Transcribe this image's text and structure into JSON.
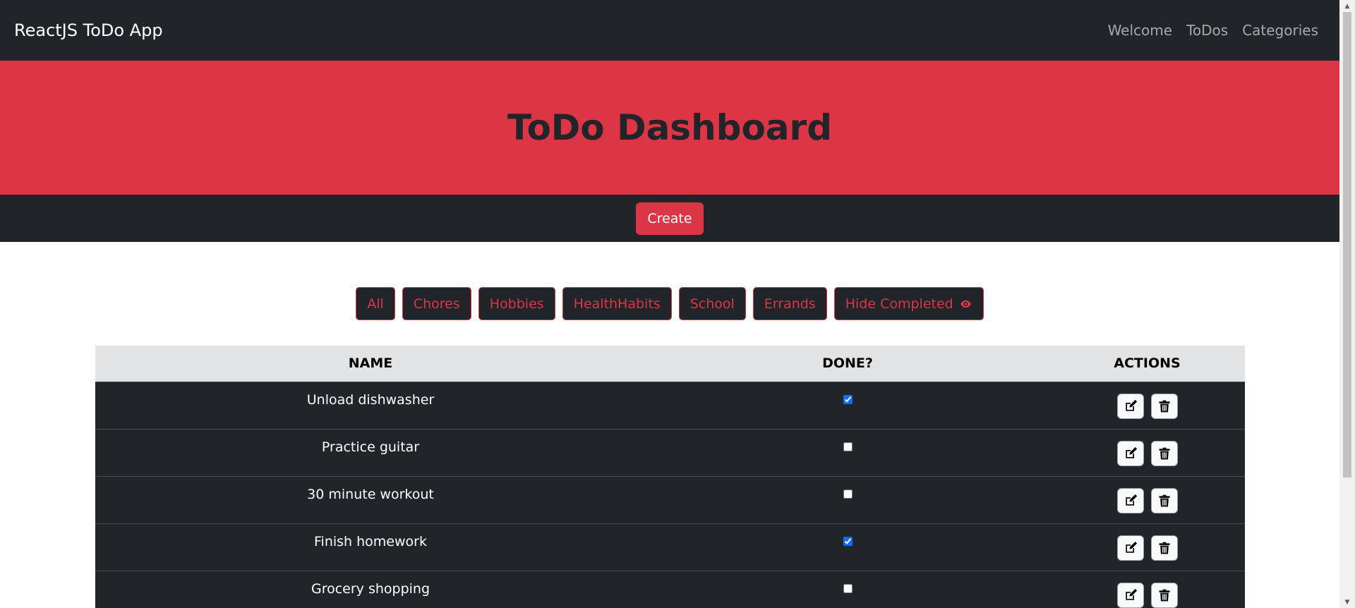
{
  "navbar": {
    "brand": "ReactJS ToDo App",
    "links": [
      "Welcome",
      "ToDos",
      "Categories"
    ]
  },
  "banner": {
    "title": "ToDo Dashboard"
  },
  "toolbar": {
    "create_label": "Create"
  },
  "filters": {
    "categories": [
      "All",
      "Chores",
      "Hobbies",
      "HealthHabits",
      "School",
      "Errands"
    ],
    "hide_completed_label": "Hide Completed"
  },
  "table": {
    "headers": [
      "NAME",
      "DONE?",
      "ACTIONS"
    ],
    "rows": [
      {
        "name": "Unload dishwasher",
        "done": true
      },
      {
        "name": "Practice guitar",
        "done": false
      },
      {
        "name": "30 minute workout",
        "done": false
      },
      {
        "name": "Finish homework",
        "done": true
      },
      {
        "name": "Grocery shopping",
        "done": false
      }
    ]
  },
  "colors": {
    "dark": "#212529",
    "accent": "#dc3545",
    "header_row": "#e2e3e5",
    "checkbox": "#0d6efd"
  },
  "icons": [
    "eye-icon",
    "edit-icon",
    "trash-icon"
  ]
}
